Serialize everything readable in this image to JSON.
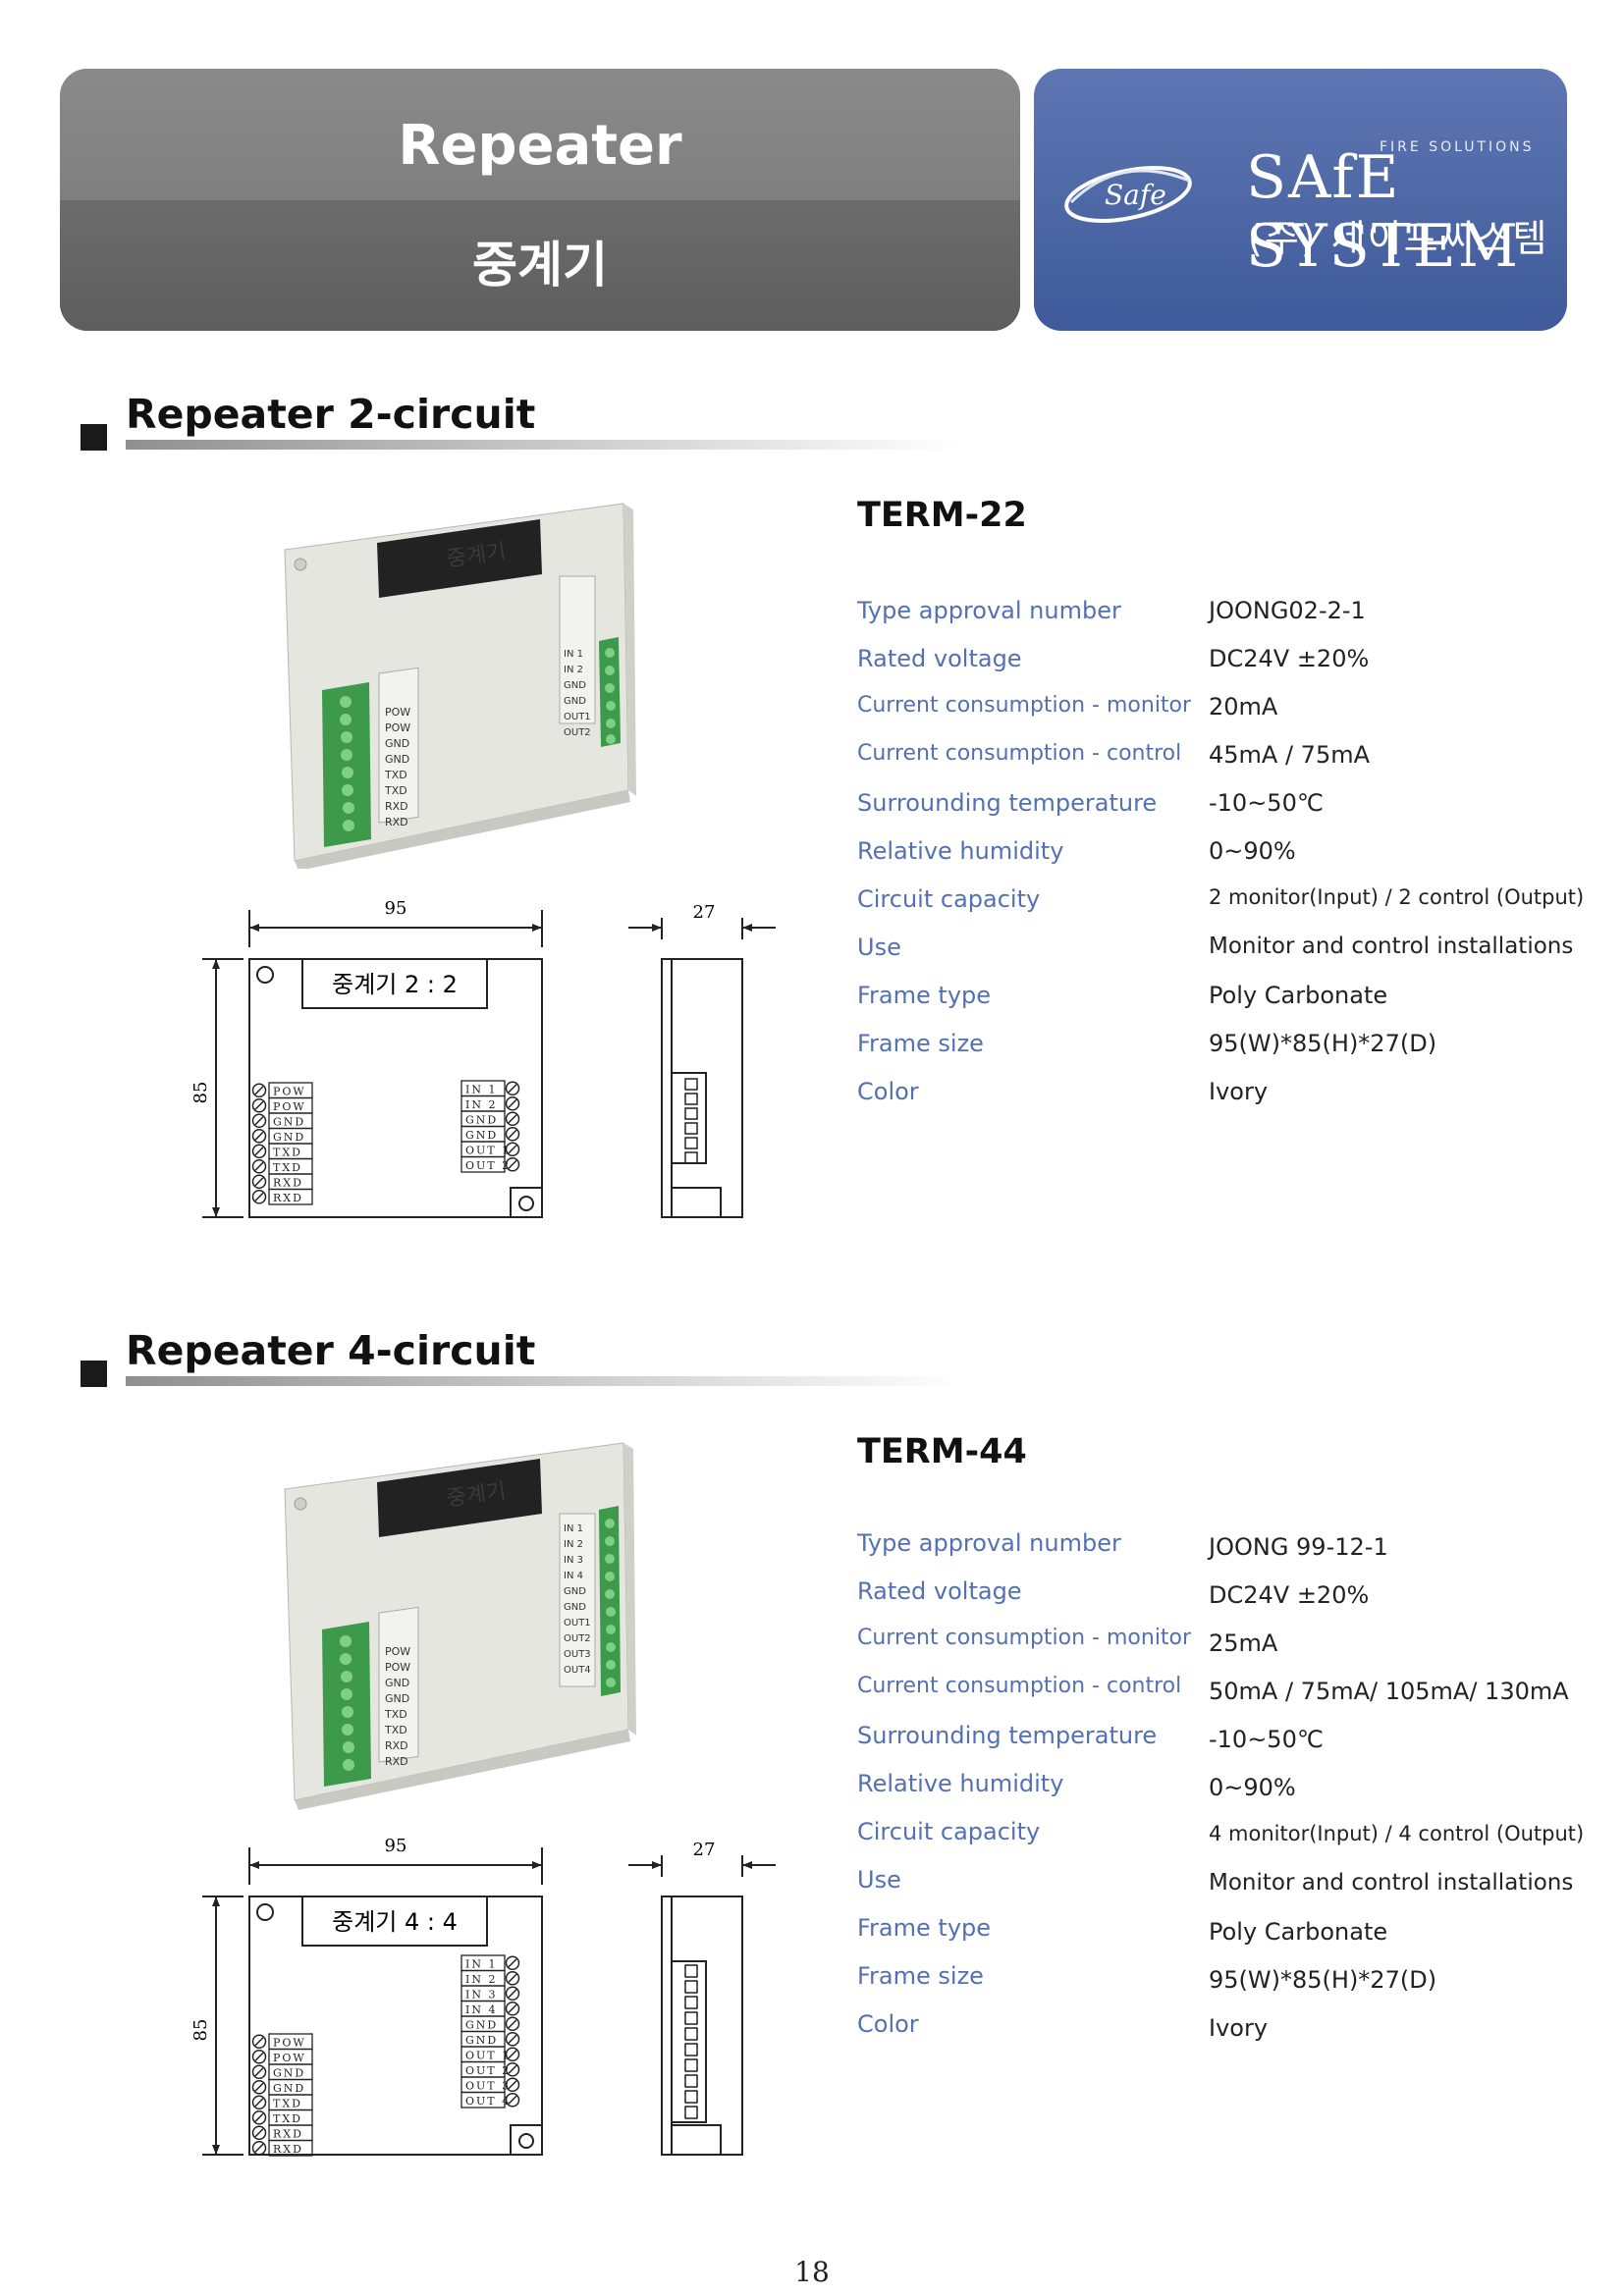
{
  "header": {
    "title_en": "Repeater",
    "title_ko": "중계기",
    "logo": {
      "oval_text": "Safe",
      "tagline": "FIRE SOLUTIONS",
      "brand": "SAfE SYSTEM",
      "company_ko": "(주) 세이프씨스템"
    }
  },
  "sections": [
    {
      "title": "Repeater 2-circuit",
      "model": "TERM-22",
      "product_label": "중계기",
      "terminals_left": [
        "POW",
        "POW",
        "GND",
        "GND",
        "TXD",
        "TXD",
        "RXD",
        "RXD"
      ],
      "terminals_right": [
        "IN 1",
        "IN 2",
        "GND",
        "GND",
        "OUT1",
        "OUT2"
      ],
      "drawing": {
        "width_label": "95",
        "depth_label": "27",
        "height_label": "85",
        "panel_label": "중계기 2 : 2",
        "left_terminals": [
          "POW",
          "POW",
          "GND",
          "GND",
          "TXD",
          "TXD",
          "RXD",
          "RXD"
        ],
        "right_terminals": [
          "IN  1",
          "IN  2",
          "GND",
          "GND",
          "OUT  1",
          "OUT  2"
        ]
      },
      "specs": [
        {
          "label": "Type approval number",
          "value": "JOONG02-2-1"
        },
        {
          "label": "Rated voltage",
          "value": "DC24V ±20%"
        },
        {
          "label": "Current consumption - monitor",
          "value": "20mA"
        },
        {
          "label": "Current consumption - control",
          "value": "45mA / 75mA"
        },
        {
          "label": "Surrounding temperature",
          "value": "-10~50℃"
        },
        {
          "label": "Relative humidity",
          "value": "0~90%"
        },
        {
          "label": "Circuit capacity",
          "value": "2 monitor(Input) / 2 control (Output)"
        },
        {
          "label": "Use",
          "value": "Monitor and control installations"
        },
        {
          "label": "Frame type",
          "value": "Poly Carbonate"
        },
        {
          "label": "Frame size",
          "value": "95(W)*85(H)*27(D)"
        },
        {
          "label": "Color",
          "value": "Ivory"
        }
      ]
    },
    {
      "title": "Repeater 4-circuit",
      "model": "TERM-44",
      "product_label": "중계기",
      "terminals_left": [
        "POW",
        "POW",
        "GND",
        "GND",
        "TXD",
        "TXD",
        "RXD",
        "RXD"
      ],
      "terminals_right": [
        "IN 1",
        "IN 2",
        "IN 3",
        "IN 4",
        "GND",
        "GND",
        "OUT1",
        "OUT2",
        "OUT3",
        "OUT4"
      ],
      "drawing": {
        "width_label": "95",
        "depth_label": "27",
        "height_label": "85",
        "panel_label": "중계기 4 : 4",
        "left_terminals": [
          "POW",
          "POW",
          "GND",
          "GND",
          "TXD",
          "TXD",
          "RXD",
          "RXD"
        ],
        "right_terminals": [
          "IN  1",
          "IN  2",
          "IN  3",
          "IN  4",
          "GND",
          "GND",
          "OUT  1",
          "OUT  2",
          "OUT  3",
          "OUT  4"
        ]
      },
      "specs": [
        {
          "label": "Type approval number",
          "value": "JOONG 99-12-1"
        },
        {
          "label": "Rated voltage",
          "value": "DC24V ±20%"
        },
        {
          "label": "Current consumption - monitor",
          "value": "25mA"
        },
        {
          "label": "Current consumption - control",
          "value": "50mA / 75mA/ 105mA/ 130mA"
        },
        {
          "label": "Surrounding temperature",
          "value": "-10~50℃"
        },
        {
          "label": "Relative humidity",
          "value": "0~90%"
        },
        {
          "label": "Circuit capacity",
          "value": "4 monitor(Input) / 4 control (Output)"
        },
        {
          "label": "Use",
          "value": "Monitor and control installations"
        },
        {
          "label": "Frame type",
          "value": "Poly Carbonate"
        },
        {
          "label": "Frame size",
          "value": "95(W)*85(H)*27(D)"
        },
        {
          "label": "Color",
          "value": "Ivory"
        }
      ]
    }
  ],
  "page_number": "18"
}
